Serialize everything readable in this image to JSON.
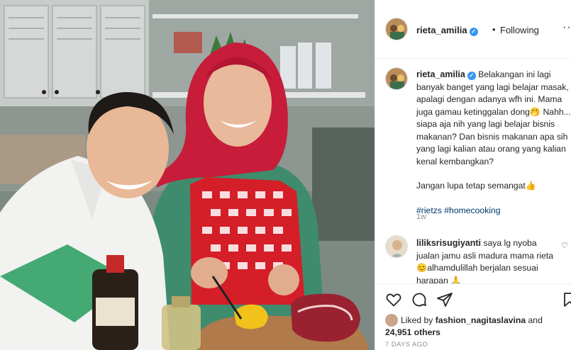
{
  "post": {
    "username": "rieta_amilia",
    "following_label": "Following",
    "more_label": "···",
    "caption": {
      "line1": "Belakangan ini lagi banyak banget yang lagi belajar masak, apalagi dengan adanya wfh ini. Mama juga gamau ketinggalan dong",
      "line2": " Nahh... siapa aja nih yang lagi belajar bisnis makanan? Dan bisnis makanan apa sih yang lagi kalian atau orang yang kalian kenal kembangkan?",
      "line3": "Jangan lupa tetap semangat",
      "hashtags": "#rietzs #homecooking",
      "time": "1w"
    }
  },
  "comment": {
    "username": "liliksrisugiyanti",
    "text1": " saya lg nyoba jualan jamu asli madura mama rieta ",
    "text2": "alhamdulillah berjalan sesuai harapan "
  },
  "likes": {
    "prefix": "Liked by ",
    "user": "fashion_nagitaslavina",
    "middle": " and ",
    "count": "24,951 others"
  },
  "date": "7 DAYS AGO",
  "icons": {
    "verified": "verified-badge-icon",
    "heart": "heart-icon",
    "comment": "comment-icon",
    "share": "share-icon",
    "save": "bookmark-icon"
  },
  "colors": {
    "accent": "#3897f0",
    "link": "#00376b",
    "muted": "#8e8e8e"
  }
}
